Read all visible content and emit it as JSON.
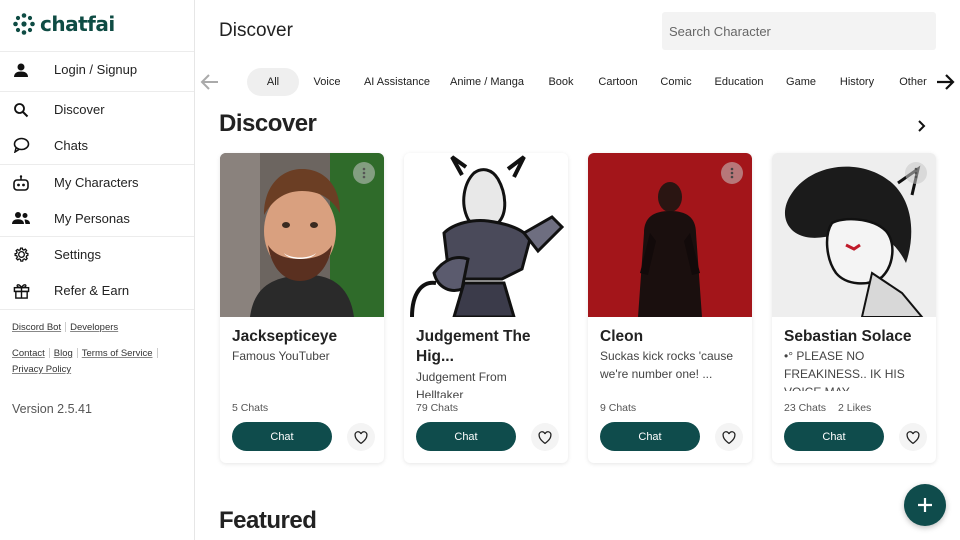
{
  "brand": {
    "name": "chatfai",
    "color": "#0f4c44"
  },
  "sidebar": {
    "items": [
      {
        "label": "Login / Signup",
        "icon": "person-icon"
      },
      {
        "label": "Discover",
        "icon": "search-icon"
      },
      {
        "label": "Chats",
        "icon": "chat-bubble-icon"
      },
      {
        "label": "My Characters",
        "icon": "robot-icon"
      },
      {
        "label": "My Personas",
        "icon": "people-icon"
      },
      {
        "label": "Settings",
        "icon": "gear-icon"
      },
      {
        "label": "Refer & Earn",
        "icon": "gift-icon"
      }
    ],
    "links_row1": [
      "Discord Bot",
      "Developers"
    ],
    "links_row2": [
      "Contact",
      "Blog",
      "Terms of Service"
    ],
    "links_row3": [
      "Privacy Policy"
    ],
    "version": "Version 2.5.41"
  },
  "header": {
    "title": "Discover",
    "search_placeholder": "Search Character"
  },
  "tabs": [
    {
      "label": "All",
      "active": true
    },
    {
      "label": "Voice"
    },
    {
      "label": "AI Assistance"
    },
    {
      "label": "Anime / Manga"
    },
    {
      "label": "Book"
    },
    {
      "label": "Cartoon"
    },
    {
      "label": "Comic"
    },
    {
      "label": "Education"
    },
    {
      "label": "Game"
    },
    {
      "label": "History"
    },
    {
      "label": "Other"
    }
  ],
  "sections": {
    "discover_title": "Discover",
    "featured_title": "Featured"
  },
  "cards": [
    {
      "name": "Jacksepticeye",
      "desc_lines": [
        "Famous YouTuber"
      ],
      "chats": "5 Chats",
      "likes": "",
      "chat_label": "Chat"
    },
    {
      "name_lines": [
        "Judgement The",
        "Hig..."
      ],
      "desc_lines": [
        "Judgement From",
        "Helltaker"
      ],
      "chats": "79 Chats",
      "likes": "",
      "chat_label": "Chat"
    },
    {
      "name": "Cleon",
      "desc_lines": [
        "Suckas kick rocks 'cause",
        "we're number one! ..."
      ],
      "chats": "9 Chats",
      "likes": "",
      "chat_label": "Chat"
    },
    {
      "name": "Sebastian Solace",
      "desc_lines": [
        "•° PLEASE NO",
        "FREAKINESS.. IK HIS",
        "VOICE MAY"
      ],
      "chats": "23 Chats",
      "likes": "2 Likes",
      "chat_label": "Chat"
    }
  ],
  "accent_color": "#0f4c4c"
}
